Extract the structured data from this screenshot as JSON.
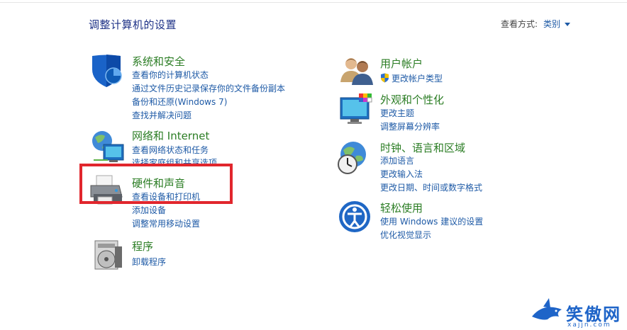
{
  "header": {
    "title": "调整计算机的设置",
    "view_by_label": "查看方式:",
    "view_by_value": "类别"
  },
  "categories": {
    "system_security": {
      "title": "系统和安全",
      "links": [
        "查看你的计算机状态",
        "通过文件历史记录保存你的文件备份副本",
        "备份和还原(Windows 7)",
        "查找并解决问题"
      ]
    },
    "network": {
      "title": "网络和 Internet",
      "links": [
        "查看网络状态和任务",
        "选择家庭组和共享选项"
      ]
    },
    "hardware_sound": {
      "title": "硬件和声音",
      "links": [
        "查看设备和打印机",
        "添加设备",
        "调整常用移动设置"
      ]
    },
    "programs": {
      "title": "程序",
      "links": [
        "卸载程序"
      ]
    },
    "user_accounts": {
      "title": "用户帐户",
      "links": [
        "更改帐户类型"
      ]
    },
    "appearance": {
      "title": "外观和个性化",
      "links": [
        "更改主题",
        "调整屏幕分辨率"
      ]
    },
    "clock_region": {
      "title": "时钟、语言和区域",
      "links": [
        "添加语言",
        "更改输入法",
        "更改日期、时间或数字格式"
      ]
    },
    "ease_access": {
      "title": "轻松使用",
      "links": [
        "使用 Windows 建议的设置",
        "优化视觉显示"
      ]
    }
  },
  "watermark": {
    "text": "笑傲网",
    "subtext": "xajjn.com"
  },
  "colors": {
    "category_title": "#2b7d24",
    "link": "#1e5aa6",
    "highlight": "#e1262d"
  }
}
